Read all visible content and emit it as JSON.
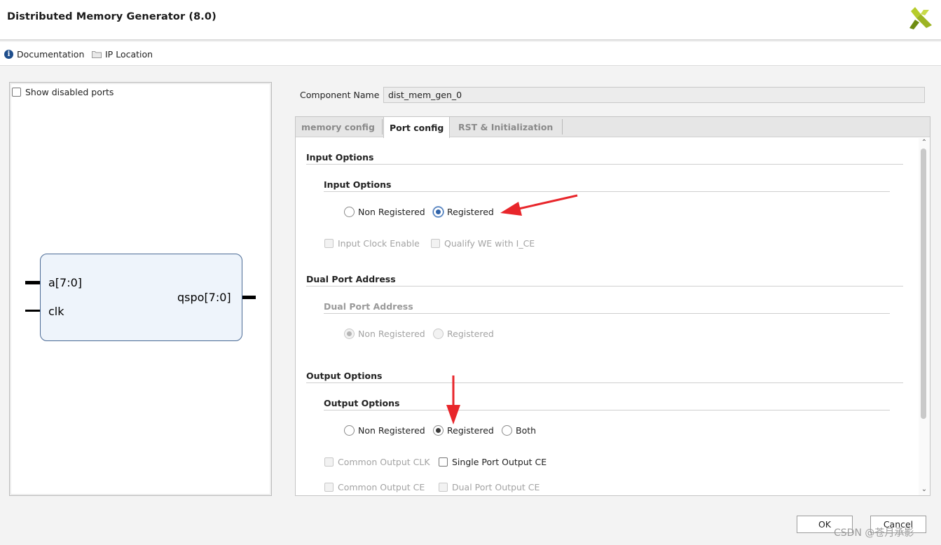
{
  "window": {
    "title": "Distributed Memory Generator (8.0)"
  },
  "toolbar": {
    "documentation": "Documentation",
    "ip_location": "IP Location"
  },
  "left": {
    "show_disabled_ports": "Show disabled ports",
    "ports": {
      "in_a": "a[7:0]",
      "in_clk": "clk",
      "out_qspo": "qspo[7:0]"
    }
  },
  "component": {
    "label": "Component Name",
    "value": "dist_mem_gen_0"
  },
  "tabs": [
    "memory config",
    "Port config",
    "RST & Initialization"
  ],
  "input_options": {
    "section": "Input Options",
    "group": "Input Options",
    "non_registered": "Non Registered",
    "registered": "Registered",
    "selected": "Registered",
    "input_clock_enable": "Input Clock Enable",
    "qualify_we": "Qualify WE with I_CE"
  },
  "dual_port_address": {
    "section": "Dual Port Address",
    "group": "Dual Port Address",
    "non_registered": "Non Registered",
    "registered": "Registered",
    "selected": "Non Registered"
  },
  "output_options": {
    "section": "Output Options",
    "group": "Output Options",
    "non_registered": "Non Registered",
    "registered": "Registered",
    "both": "Both",
    "selected": "Registered",
    "common_output_clk": "Common Output CLK",
    "single_port_output_ce": "Single Port Output CE",
    "common_output_ce": "Common Output CE",
    "dual_port_output_ce": "Dual Port Output CE"
  },
  "buttons": {
    "ok": "OK",
    "cancel": "Cancel"
  },
  "watermark": "CSDN @苍月承影",
  "colors": {
    "annotation_arrow": "#e8262b",
    "block_fill": "#eef4fb",
    "block_border": "#4a6a95",
    "logo_green": "#9cb423"
  }
}
